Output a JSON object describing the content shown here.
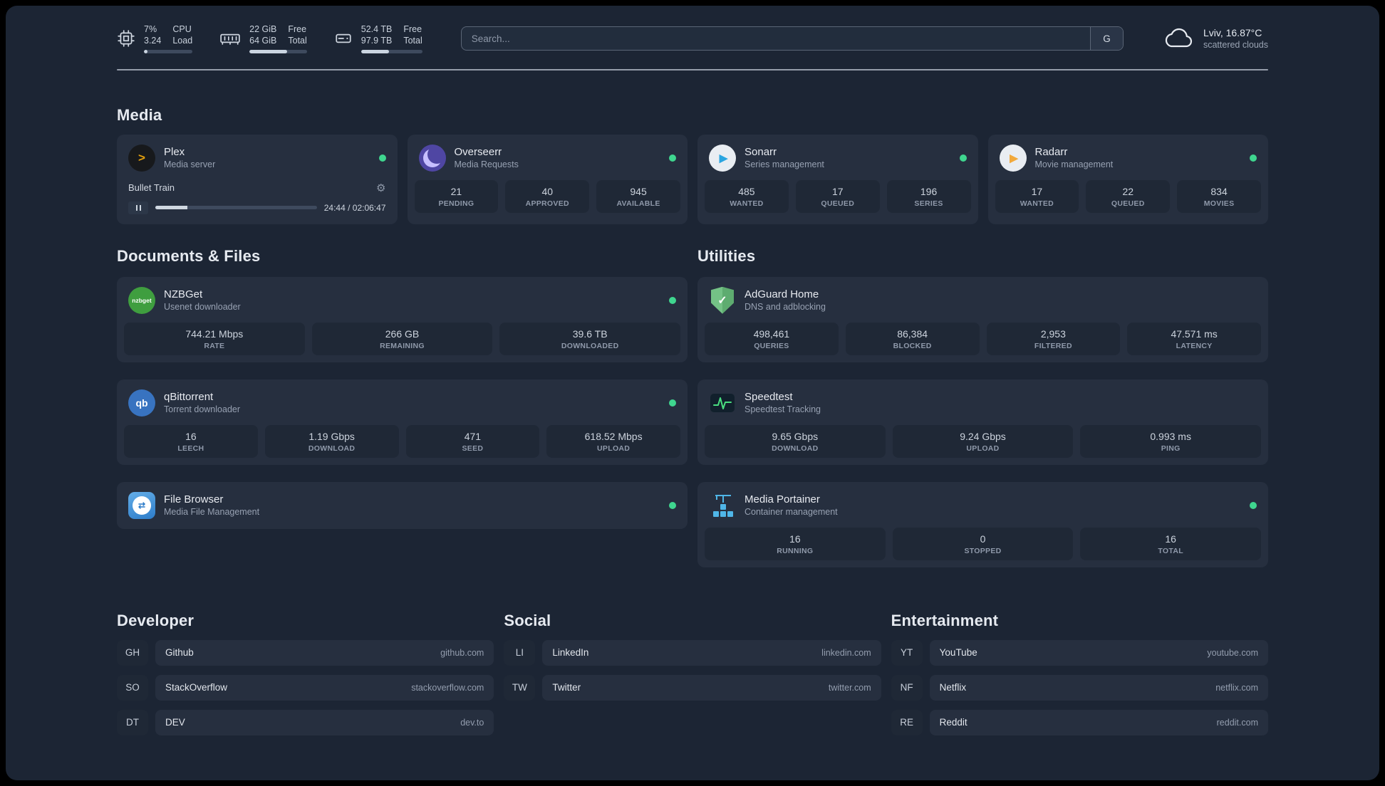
{
  "topbar": {
    "resources": [
      {
        "values": [
          "7%",
          "3.24"
        ],
        "labels": [
          "CPU",
          "Load"
        ],
        "progress_pct": 7
      },
      {
        "values": [
          "22 GiB",
          "64 GiB"
        ],
        "labels": [
          "Free",
          "Total"
        ],
        "progress_pct": 66
      },
      {
        "values": [
          "52.4 TB",
          "97.9 TB"
        ],
        "labels": [
          "Free",
          "Total"
        ],
        "progress_pct": 46
      }
    ],
    "search": {
      "placeholder": "Search...",
      "provider_label": "G"
    },
    "weather": {
      "location": "Lviv, 16.87°C",
      "condition": "scattered clouds"
    }
  },
  "icons": {
    "plex": ">",
    "sonarr": "▶",
    "radarr": "▶",
    "nzbget": "nzbget",
    "qbittorrent": "qb",
    "filebrowser": "⇄",
    "adguard": "✓",
    "gear": "⚙"
  },
  "groups": {
    "media": {
      "title": "Media",
      "plex": {
        "name": "Plex",
        "description": "Media server",
        "now_playing": {
          "title": "Bullet Train",
          "time": "24:44 / 02:06:47",
          "progress_pct": 20
        }
      },
      "overseerr": {
        "name": "Overseerr",
        "description": "Media Requests",
        "stats": [
          {
            "value": "21",
            "label": "PENDING"
          },
          {
            "value": "40",
            "label": "APPROVED"
          },
          {
            "value": "945",
            "label": "AVAILABLE"
          }
        ]
      },
      "sonarr": {
        "name": "Sonarr",
        "description": "Series management",
        "stats": [
          {
            "value": "485",
            "label": "WANTED"
          },
          {
            "value": "17",
            "label": "QUEUED"
          },
          {
            "value": "196",
            "label": "SERIES"
          }
        ]
      },
      "radarr": {
        "name": "Radarr",
        "description": "Movie management",
        "stats": [
          {
            "value": "17",
            "label": "WANTED"
          },
          {
            "value": "22",
            "label": "QUEUED"
          },
          {
            "value": "834",
            "label": "MOVIES"
          }
        ]
      }
    },
    "documents": {
      "title": "Documents & Files",
      "nzbget": {
        "name": "NZBGet",
        "description": "Usenet downloader",
        "stats": [
          {
            "value": "744.21 Mbps",
            "label": "RATE"
          },
          {
            "value": "266 GB",
            "label": "REMAINING"
          },
          {
            "value": "39.6 TB",
            "label": "DOWNLOADED"
          }
        ]
      },
      "qbittorrent": {
        "name": "qBittorrent",
        "description": "Torrent downloader",
        "stats": [
          {
            "value": "16",
            "label": "LEECH"
          },
          {
            "value": "1.19 Gbps",
            "label": "DOWNLOAD"
          },
          {
            "value": "471",
            "label": "SEED"
          },
          {
            "value": "618.52 Mbps",
            "label": "UPLOAD"
          }
        ]
      },
      "filebrowser": {
        "name": "File Browser",
        "description": "Media File Management"
      }
    },
    "utilities": {
      "title": "Utilities",
      "adguard": {
        "name": "AdGuard Home",
        "description": "DNS and adblocking",
        "stats": [
          {
            "value": "498,461",
            "label": "QUERIES"
          },
          {
            "value": "86,384",
            "label": "BLOCKED"
          },
          {
            "value": "2,953",
            "label": "FILTERED"
          },
          {
            "value": "47.571 ms",
            "label": "LATENCY"
          }
        ]
      },
      "speedtest": {
        "name": "Speedtest",
        "description": "Speedtest Tracking",
        "stats": [
          {
            "value": "9.65 Gbps",
            "label": "DOWNLOAD"
          },
          {
            "value": "9.24 Gbps",
            "label": "UPLOAD"
          },
          {
            "value": "0.993 ms",
            "label": "PING"
          }
        ]
      },
      "portainer": {
        "name": "Media Portainer",
        "description": "Container management",
        "stats": [
          {
            "value": "16",
            "label": "RUNNING"
          },
          {
            "value": "0",
            "label": "STOPPED"
          },
          {
            "value": "16",
            "label": "TOTAL"
          }
        ]
      }
    }
  },
  "bookmarks": [
    {
      "title": "Developer",
      "items": [
        {
          "abbr": "GH",
          "name": "Github",
          "url": "github.com"
        },
        {
          "abbr": "SO",
          "name": "StackOverflow",
          "url": "stackoverflow.com"
        },
        {
          "abbr": "DT",
          "name": "DEV",
          "url": "dev.to"
        }
      ]
    },
    {
      "title": "Social",
      "items": [
        {
          "abbr": "LI",
          "name": "LinkedIn",
          "url": "linkedin.com"
        },
        {
          "abbr": "TW",
          "name": "Twitter",
          "url": "twitter.com"
        }
      ]
    },
    {
      "title": "Entertainment",
      "items": [
        {
          "abbr": "YT",
          "name": "YouTube",
          "url": "youtube.com"
        },
        {
          "abbr": "NF",
          "name": "Netflix",
          "url": "netflix.com"
        },
        {
          "abbr": "RE",
          "name": "Reddit",
          "url": "reddit.com"
        }
      ]
    }
  ]
}
